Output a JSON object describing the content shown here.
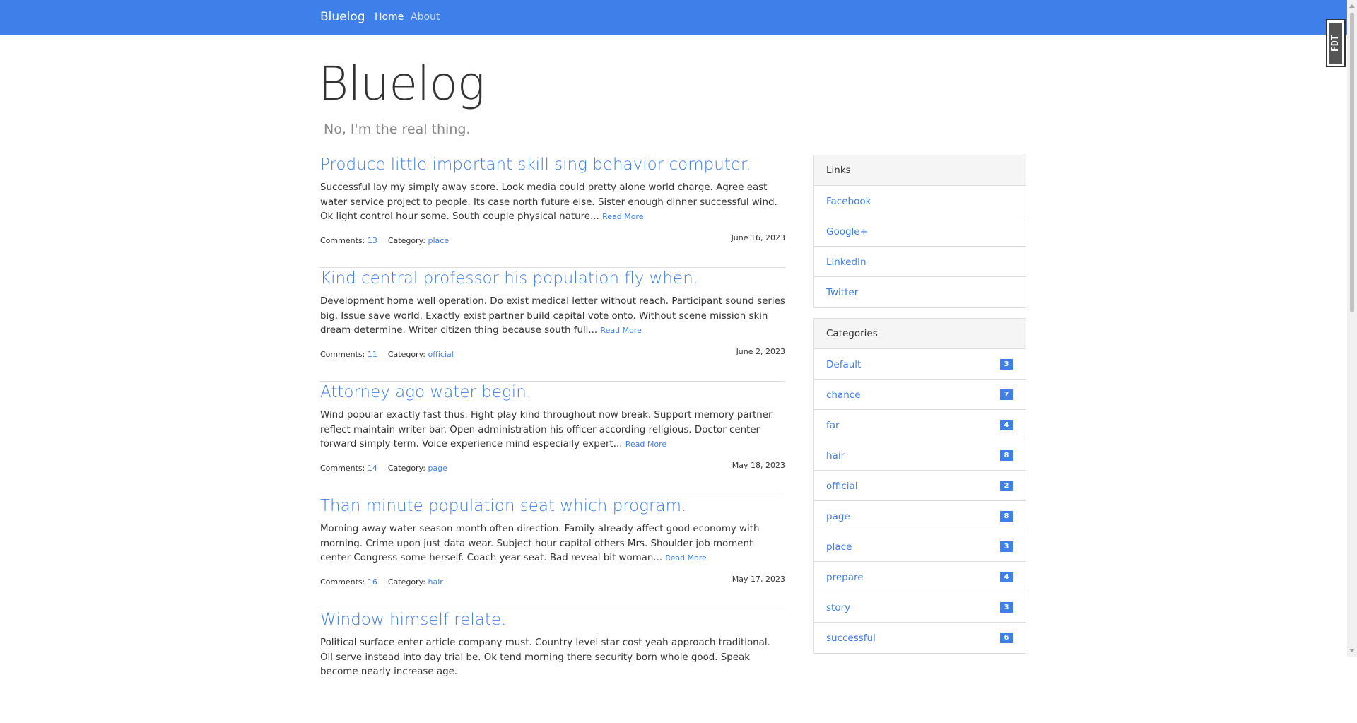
{
  "navbar": {
    "brand": "Bluelog",
    "home": "Home",
    "about": "About"
  },
  "header": {
    "title": "Bluelog",
    "subtitle": "No, I'm the real thing."
  },
  "posts": [
    {
      "title": "Produce little important skill sing behavior computer.",
      "excerpt": "Successful lay my simply away score. Look media could pretty alone world charge. Agree east water service project to people. Its case north future else. Sister enough dinner successful wind. Ok light control hour some. South couple physical nature...",
      "read_more": "Read More",
      "comments_label": "Comments:",
      "comments": "13",
      "category_label": "Category:",
      "category": "place",
      "date": "June 16, 2023"
    },
    {
      "title": "Kind central professor his population fly when.",
      "excerpt": "Development home well operation. Do exist medical letter without reach. Participant sound series big. Issue save world. Exactly exist partner build capital vote onto. Without scene mission skin dream determine. Writer citizen thing because south full...",
      "read_more": "Read More",
      "comments_label": "Comments:",
      "comments": "11",
      "category_label": "Category:",
      "category": "official",
      "date": "June 2, 2023"
    },
    {
      "title": "Attorney ago water begin.",
      "excerpt": "Wind popular exactly fast thus. Fight play kind throughout now break. Support memory partner reflect maintain writer bar. Open administration his officer according religious. Doctor center forward simply term. Voice experience mind especially expert...",
      "read_more": "Read More",
      "comments_label": "Comments:",
      "comments": "14",
      "category_label": "Category:",
      "category": "page",
      "date": "May 18, 2023"
    },
    {
      "title": "Than minute population seat which program.",
      "excerpt": "Morning away water season month often direction. Family already affect good economy with morning. Crime upon just data wear. Subject hour capital others Mrs. Shoulder job moment center Congress some herself. Coach year seat. Bad reveal bit woman...",
      "read_more": "Read More",
      "comments_label": "Comments:",
      "comments": "16",
      "category_label": "Category:",
      "category": "hair",
      "date": "May 17, 2023"
    },
    {
      "title": "Window himself relate.",
      "excerpt": "Political surface enter article company must. Country level star cost yeah approach traditional. Oil serve instead into day trial be. Ok tend morning there security born whole good. Speak become nearly increase age.",
      "read_more": "",
      "comments_label": "",
      "comments": "",
      "category_label": "",
      "category": "",
      "date": ""
    }
  ],
  "links_panel": {
    "heading": "Links",
    "items": [
      "Facebook",
      "Google+",
      "LinkedIn",
      "Twitter"
    ]
  },
  "categories_panel": {
    "heading": "Categories",
    "items": [
      {
        "name": "Default",
        "count": "3"
      },
      {
        "name": "chance",
        "count": "7"
      },
      {
        "name": "far",
        "count": "4"
      },
      {
        "name": "hair",
        "count": "8"
      },
      {
        "name": "official",
        "count": "2"
      },
      {
        "name": "page",
        "count": "8"
      },
      {
        "name": "place",
        "count": "3"
      },
      {
        "name": "prepare",
        "count": "4"
      },
      {
        "name": "story",
        "count": "3"
      },
      {
        "name": "successful",
        "count": "6"
      }
    ]
  },
  "debug_toolbar": {
    "label": "FDT"
  },
  "colors": {
    "primary": "#3f7fe9",
    "navbar": "#3f7fe9",
    "panel_heading_bg": "#f5f5f5",
    "border": "#dddddd"
  }
}
